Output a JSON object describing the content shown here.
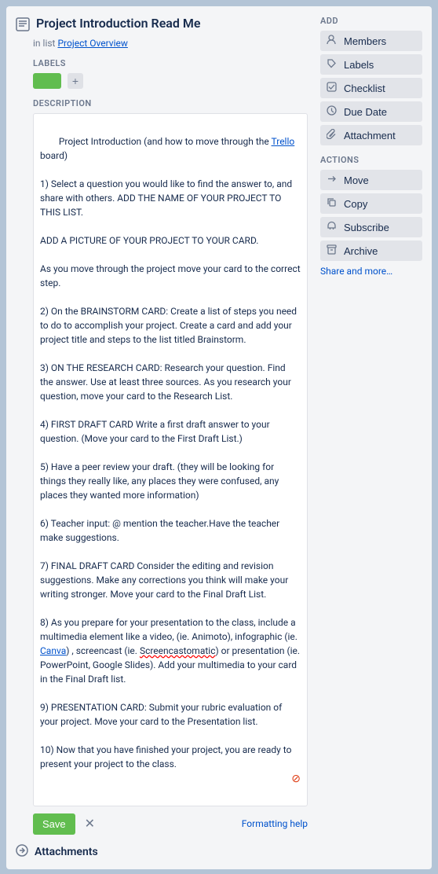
{
  "card": {
    "title": "Project Introduction Read Me",
    "list_ref_prefix": "in list",
    "list_ref_link": "Project Overview"
  },
  "labels_section": {
    "label": "Labels",
    "add_btn": "+"
  },
  "description": {
    "label": "Description",
    "content": "Project Introduction (and how to move through the Trello board)\n1) Select a question you would like to find the answer to, and share with others. ADD THE NAME OF YOUR PROJECT TO THIS LIST.\nADD A PICTURE OF YOUR PROJECT TO YOUR CARD.\nAs you move through the project move your card to the correct step.\n2) On the BRAINSTORM CARD: Create a list of steps you need to do to accomplish your project. Create a card and add your project title and steps to the list titled Brainstorm.\n3) ON THE RESEARCH CARD: Research your question. Find the answer. Use at least three sources. As you research your question, move your card to the Research List.\n4) FIRST DRAFT CARD Write a first draft answer to your question. (Move your card to the First Draft List.)\n5) Have a peer review your draft. (they will be looking for things they really like, any places they were confused, any places they wanted more information)\n6) Teacher input: @ mention the teacher.Have the teacher make suggestions.\n7) FINAL DRAFT CARD Consider the editing and revision suggestions. Make any corrections you think will make your writing stronger. Move your card to the Final Draft List.\n8) As you prepare for your presentation to the class, include a multimedia element like a video, (ie. Animoto), infographic (ie. Canva) , screencast (ie. Screencastomatic) or presentation (ie. PowerPoint, Google Slides). Add your multimedia to your card in the Final Draft list.\n9) PRESENTATION CARD: Submit your rubric evaluation of your project. Move your card to the Presentation list.\n10) Now that you have finished your project, you are ready to present your project to the class."
  },
  "action_buttons": {
    "save": "Save",
    "formatting_help": "Formatting help"
  },
  "attachments": {
    "label": "Attachments"
  },
  "sidebar": {
    "add_title": "Add",
    "members_btn": "Members",
    "labels_btn": "Labels",
    "checklist_btn": "Checklist",
    "due_date_btn": "Due Date",
    "attachment_btn": "Attachment",
    "actions_title": "Actions",
    "move_btn": "Move",
    "copy_btn": "Copy",
    "subscribe_btn": "Subscribe",
    "archive_btn": "Archive",
    "share_more": "Share and more…"
  }
}
